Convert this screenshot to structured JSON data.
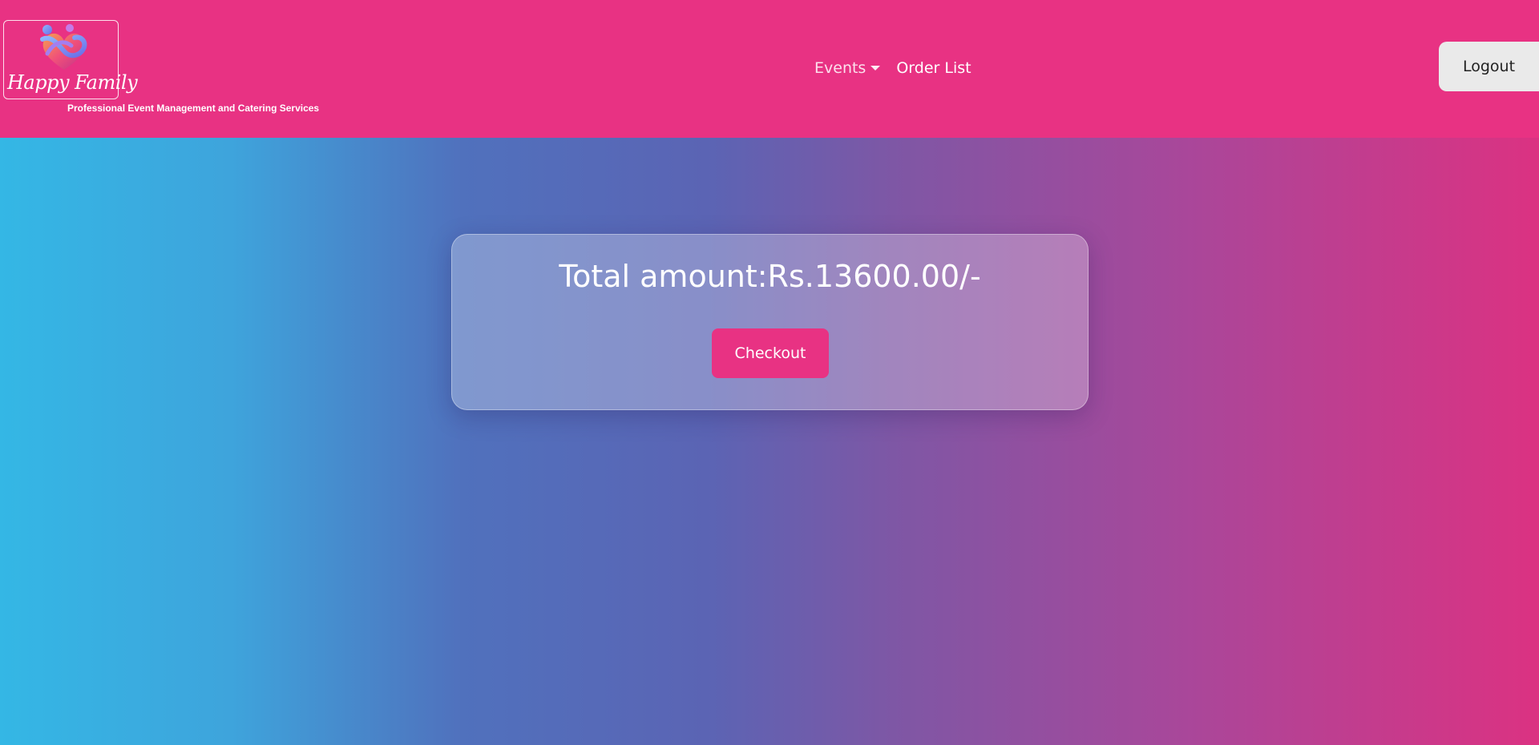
{
  "brand": {
    "logo_icon": "happy-family-heart-logo",
    "logo_text": "Happy Family",
    "tagline": "Professional Event Management and Catering Services"
  },
  "nav": {
    "events_label": "Events",
    "order_list_label": "Order List",
    "logout_label": "Logout"
  },
  "cart": {
    "total_text": "Total amount:Rs.13600.00/-",
    "checkout_label": "Checkout"
  },
  "colors": {
    "brand_pink": "#e83283",
    "gradient_start": "#34b7e5",
    "gradient_end": "#db3282"
  }
}
